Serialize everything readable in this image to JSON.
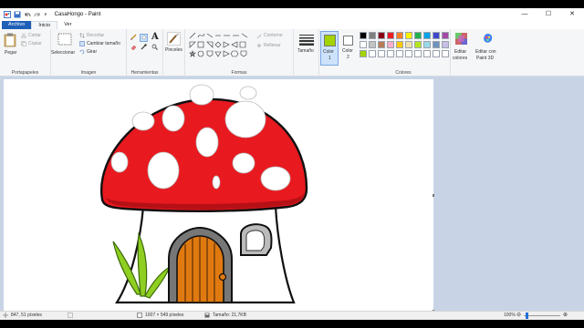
{
  "window": {
    "title": "CasaHongo - Paint",
    "qat_dropdown": "∨",
    "controls": {
      "minimize": "—",
      "maximize": "☐",
      "close": "✕"
    }
  },
  "tabs": {
    "file": "Archivo",
    "home": "Inicio",
    "view": "Ver"
  },
  "ribbon": {
    "clipboard": {
      "paste": "Pegar",
      "cut": "Cortar",
      "copy": "Copiar",
      "label": "Portapapeles"
    },
    "image": {
      "select": "Seleccionar",
      "crop": "Recortar",
      "resize": "Cambiar tamaño",
      "rotate": "Girar",
      "label": "Imagen"
    },
    "tools": {
      "label": "Herramientas",
      "text_tool": "A"
    },
    "brushes": {
      "label": "Pinceles"
    },
    "shapes": {
      "outline": "Contorno",
      "fill": "Rellenar",
      "label": "Formas"
    },
    "size": {
      "label": "Tamaño"
    },
    "color1": {
      "label": "Color",
      "number": "1",
      "value": "#a3d300"
    },
    "color2": {
      "label": "Color",
      "number": "2",
      "value": "#ffffff"
    },
    "edit_colors": {
      "line1": "Editar",
      "line2": "colores"
    },
    "paint3d": {
      "line1": "Editar con",
      "line2": "Paint 3D"
    },
    "colors_label": "Colores",
    "palette": [
      "#000000",
      "#7f7f7f",
      "#880015",
      "#ed1c24",
      "#ff7f27",
      "#fff200",
      "#22b14c",
      "#00a2e8",
      "#3f48cc",
      "#a349a4",
      "#ffffff",
      "#c3c3c3",
      "#b97a57",
      "#ffaec9",
      "#ffc90e",
      "#efe4b0",
      "#b5e61d",
      "#99d9ea",
      "#7092be",
      "#c8bfe7",
      "#a3d300",
      "#ffffff",
      "#ffffff",
      "#ffffff",
      "#ffffff",
      "#ffffff",
      "#ffffff",
      "#ffffff",
      "#ffffff",
      "#ffffff"
    ]
  },
  "status": {
    "cursor_pos": "847, 51 píxeles",
    "image_size": "1007 × 549 píxeles",
    "file_size": "Tamaño: 21,7KB",
    "zoom": "100%",
    "zoom_out": "⊖",
    "zoom_in": "⊕"
  }
}
